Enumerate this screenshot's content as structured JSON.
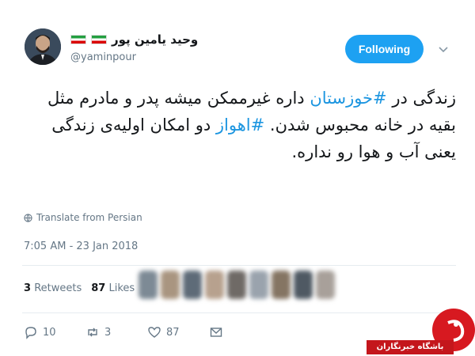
{
  "author": {
    "display_name": "وحید یامین پور",
    "handle": "@yaminpour",
    "flag_icon": "iran-flag-icon"
  },
  "follow_button": {
    "label": "Following"
  },
  "tweet": {
    "segments": [
      {
        "text": "زندگی در ",
        "hashtag": false
      },
      {
        "text": "#خوزستان",
        "hashtag": true
      },
      {
        "text": " داره غیرممکن میشه پدر و مادرم مثل بقیه در خانه محبوس شدن. ",
        "hashtag": false
      },
      {
        "text": "#اهواز",
        "hashtag": true
      },
      {
        "text": " دو امکان اولیه‌ی زندگی یعنی آب و هوا رو نداره.",
        "hashtag": false
      }
    ]
  },
  "translate_label": "Translate from Persian",
  "timestamp": "7:05 AM - 23 Jan 2018",
  "stats": {
    "retweets_count": "3",
    "retweets_label": "Retweets",
    "likes_count": "87",
    "likes_label": "Likes"
  },
  "actions": {
    "reply_count": "10",
    "retweet_count": "3",
    "like_count": "87"
  },
  "watermark": {
    "text": "باشگاه خبرنگاران"
  },
  "colors": {
    "accent": "#1da1f2",
    "hashtag": "#1b95e0",
    "muted": "#657786",
    "watermark": "#d71920"
  }
}
